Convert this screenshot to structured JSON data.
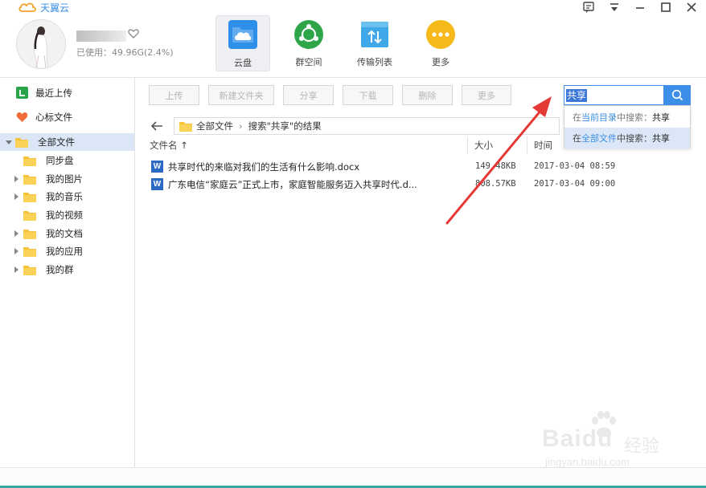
{
  "app": {
    "title": "天翼云"
  },
  "user": {
    "storage": "已使用：49.96G(2.4%)"
  },
  "nav": {
    "tabs": [
      {
        "label": "云盘",
        "icon": "cloud-drive-icon",
        "color": "#2e8fe8",
        "active": true
      },
      {
        "label": "群空间",
        "icon": "group-space-icon",
        "color": "#2fa54a",
        "active": false
      },
      {
        "label": "传输列表",
        "icon": "transfer-list-icon",
        "color": "#3fa8e8",
        "active": false
      },
      {
        "label": "更多",
        "icon": "more-icon",
        "color": "#f5b91a",
        "active": false
      }
    ]
  },
  "sidebar": {
    "items": [
      {
        "label": "最近上传",
        "icon": "recent-upload-icon",
        "color": "#2aa44a"
      },
      {
        "label": "心标文件",
        "icon": "heart-icon",
        "color": "#ef6d3b"
      },
      {
        "label": "全部文件",
        "icon": "folder-icon",
        "selected": true,
        "expanded": true
      },
      {
        "label": "同步盘",
        "icon": "folder-icon"
      },
      {
        "label": "我的图片",
        "icon": "folder-icon",
        "has_children": true
      },
      {
        "label": "我的音乐",
        "icon": "folder-icon",
        "has_children": true
      },
      {
        "label": "我的视频",
        "icon": "folder-icon"
      },
      {
        "label": "我的文档",
        "icon": "folder-icon",
        "has_children": true
      },
      {
        "label": "我的应用",
        "icon": "folder-icon",
        "has_children": true
      },
      {
        "label": "我的群",
        "icon": "folder-icon",
        "has_children": true
      }
    ]
  },
  "toolbar": {
    "upload": "上传",
    "new_folder": "新建文件夹",
    "share": "分享",
    "download": "下载",
    "delete": "删除",
    "more": "更多"
  },
  "search": {
    "value": "共享",
    "suggestions": [
      {
        "prefix": "在",
        "scope": "当前目录",
        "suffix": "中搜索：",
        "keyword": "共享"
      },
      {
        "prefix": "在",
        "scope": "全部文件",
        "suffix": "中搜索：",
        "keyword": "共享"
      }
    ]
  },
  "breadcrumb": {
    "root": "全部文件",
    "current": "搜索\"共享\"的结果"
  },
  "table": {
    "columns": {
      "name": "文件名 ↑",
      "size": "大小",
      "time": "时间"
    },
    "rows": [
      {
        "icon": "word-doc-icon",
        "badge": "W",
        "name": "共享时代的来临对我们的生活有什么影响.docx",
        "size": "149.48KB",
        "time": "2017-03-04 08:59"
      },
      {
        "icon": "word-doc-icon",
        "badge": "W",
        "name": "广东电信“家庭云”正式上市，家庭智能服务迈入共享时代.d...",
        "size": "808.57KB",
        "time": "2017-03-04 09:00"
      }
    ]
  },
  "watermark": {
    "brand": "Baidu",
    "sub": "经验",
    "url": "jingyan.baidu.com"
  },
  "colors": {
    "accent": "#3d8ee8",
    "selected_bg": "#dbe7f6",
    "annotation_arrow": "#e53935"
  }
}
